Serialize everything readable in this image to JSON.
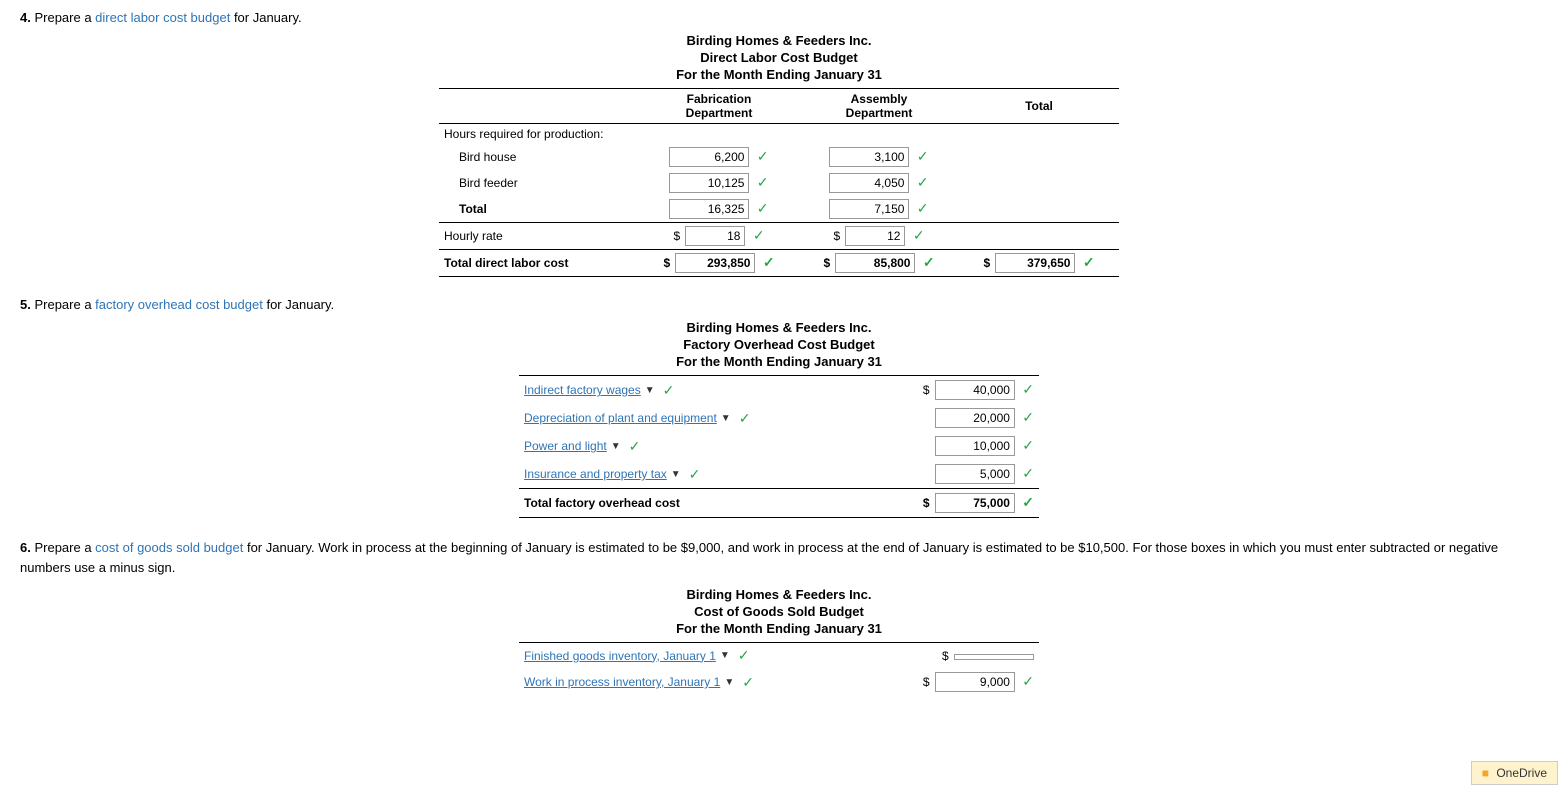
{
  "questions": {
    "q4": {
      "number": "4.",
      "text": "Prepare a ",
      "link": "direct labor cost budget",
      "text2": " for January."
    },
    "q5": {
      "number": "5.",
      "text": "Prepare a ",
      "link": "factory overhead cost budget",
      "text2": " for January."
    },
    "q6": {
      "number": "6.",
      "text": "Prepare a ",
      "link": "cost of goods sold budget",
      "text2": " for January. Work in process at the beginning of January is estimated to be $9,000, and work in process at the end of January is estimated to be $10,500. For those boxes in which you must enter subtracted or negative numbers use a minus sign."
    }
  },
  "direct_labor": {
    "company": "Birding Homes & Feeders Inc.",
    "title": "Direct Labor Cost Budget",
    "subtitle": "For the Month Ending January 31",
    "col1": "Fabrication",
    "col1b": "Department",
    "col2": "Assembly",
    "col2b": "Department",
    "col3": "Total",
    "section_label": "Hours required for production:",
    "rows": [
      {
        "label": "Bird house",
        "fab": "6,200",
        "asm": "3,100",
        "total": ""
      },
      {
        "label": "Bird feeder",
        "fab": "10,125",
        "asm": "4,050",
        "total": ""
      },
      {
        "label": "Total",
        "fab": "16,325",
        "asm": "7,150",
        "total": ""
      }
    ],
    "hourly_rate_label": "Hourly rate",
    "hourly_rate_fab": "18",
    "hourly_rate_asm": "12",
    "total_labor_label": "Total direct labor cost",
    "total_labor_fab": "293,850",
    "total_labor_asm": "85,800",
    "total_labor_total": "379,650"
  },
  "factory_overhead": {
    "company": "Birding Homes & Feeders Inc.",
    "title": "Factory Overhead Cost Budget",
    "subtitle": "For the Month Ending January 31",
    "rows": [
      {
        "label": "Indirect factory wages",
        "value": "40,000"
      },
      {
        "label": "Depreciation of plant and equipment",
        "value": "20,000"
      },
      {
        "label": "Power and light",
        "value": "10,000"
      },
      {
        "label": "Insurance and property tax",
        "value": "5,000"
      }
    ],
    "total_label": "Total factory overhead cost",
    "total_value": "75,000"
  },
  "cost_of_goods": {
    "company": "Birding Homes & Feeders Inc.",
    "title": "Cost of Goods Sold Budget",
    "subtitle": "For the Month Ending January 31",
    "rows": [
      {
        "label": "Finished goods inventory, January 1",
        "value": "",
        "has_dropdown": true
      },
      {
        "label": "Work in process inventory, January 1",
        "value": "9,000",
        "has_dropdown": true
      }
    ]
  },
  "icons": {
    "check": "✓",
    "dropdown_arrow": "▼",
    "onedrive": "OneDrive"
  }
}
